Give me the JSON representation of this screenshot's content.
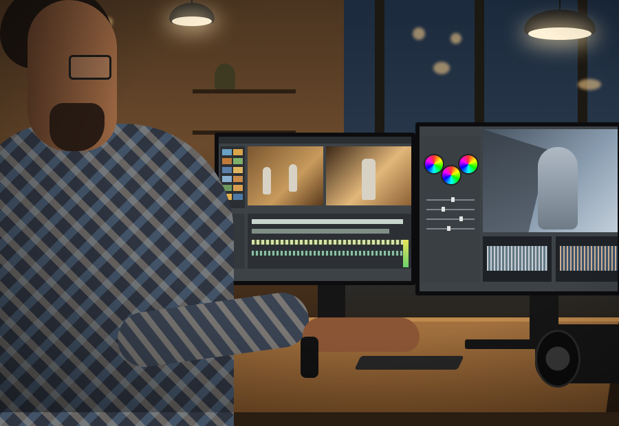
{
  "scene": {
    "subject": "person",
    "workstation": {
      "monitors": [
        {
          "content": "video-editor-timeline"
        },
        {
          "content": "color-grading-panel"
        }
      ]
    }
  },
  "colors": {
    "ambient": "#a4723f",
    "screen_ui": "#3d4246"
  }
}
